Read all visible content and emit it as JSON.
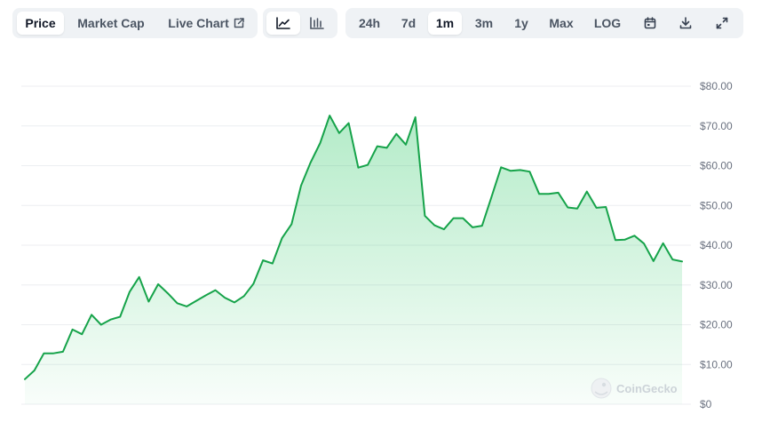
{
  "toolbar": {
    "metric_tabs": [
      {
        "label": "Price",
        "active": true
      },
      {
        "label": "Market Cap",
        "active": false
      },
      {
        "label": "Live Chart",
        "active": false
      }
    ],
    "chart_styles": [
      {
        "icon": "line-chart-icon",
        "active": true
      },
      {
        "icon": "candlestick-icon",
        "active": false
      }
    ],
    "ranges": [
      {
        "label": "24h",
        "active": false
      },
      {
        "label": "7d",
        "active": false
      },
      {
        "label": "1m",
        "active": true
      },
      {
        "label": "3m",
        "active": false
      },
      {
        "label": "1y",
        "active": false
      },
      {
        "label": "Max",
        "active": false
      },
      {
        "label": "LOG",
        "active": false
      }
    ],
    "actions": [
      "calendar-icon",
      "download-icon",
      "expand-icon"
    ]
  },
  "watermark": "CoinGecko",
  "colors": {
    "line": "#16a34a",
    "fill_top": "#22c55e",
    "grid": "#eceef1",
    "active_bg": "#ffffff",
    "group_bg": "#eff2f5"
  },
  "chart_data": {
    "type": "area",
    "title": "",
    "xlabel": "",
    "ylabel": "",
    "ylim": [
      0,
      80
    ],
    "y_ticks": [
      0,
      10,
      20,
      30,
      40,
      50,
      60,
      70,
      80
    ],
    "y_tick_labels": [
      "$0",
      "$10.00",
      "$20.00",
      "$30.00",
      "$40.00",
      "$50.00",
      "$60.00",
      "$70.00",
      "$80.00"
    ],
    "grid": true,
    "legend": "none",
    "series": [
      {
        "values": [
          6.3,
          8.5,
          12.8,
          12.8,
          13.2,
          18.8,
          17.6,
          22.5,
          20.0,
          21.3,
          22.0,
          28.3,
          32.0,
          25.8,
          30.2,
          27.9,
          25.4,
          24.6,
          26.0,
          27.4,
          28.7,
          26.8,
          25.6,
          27.2,
          30.3,
          36.2,
          35.4,
          41.8,
          45.3,
          55.0,
          60.8,
          65.7,
          72.6,
          68.2,
          70.7,
          59.5,
          60.2,
          64.9,
          64.5,
          68.0,
          65.3,
          72.2,
          47.4,
          45.0,
          44.0,
          46.8,
          46.8,
          44.5,
          44.9,
          52.2,
          59.6,
          58.7,
          58.9,
          58.5,
          52.9,
          52.9,
          53.2,
          49.5,
          49.2,
          53.5,
          49.4,
          49.6,
          41.3,
          41.4,
          42.4,
          40.4,
          36.0,
          40.5,
          36.4,
          35.9
        ]
      }
    ]
  }
}
